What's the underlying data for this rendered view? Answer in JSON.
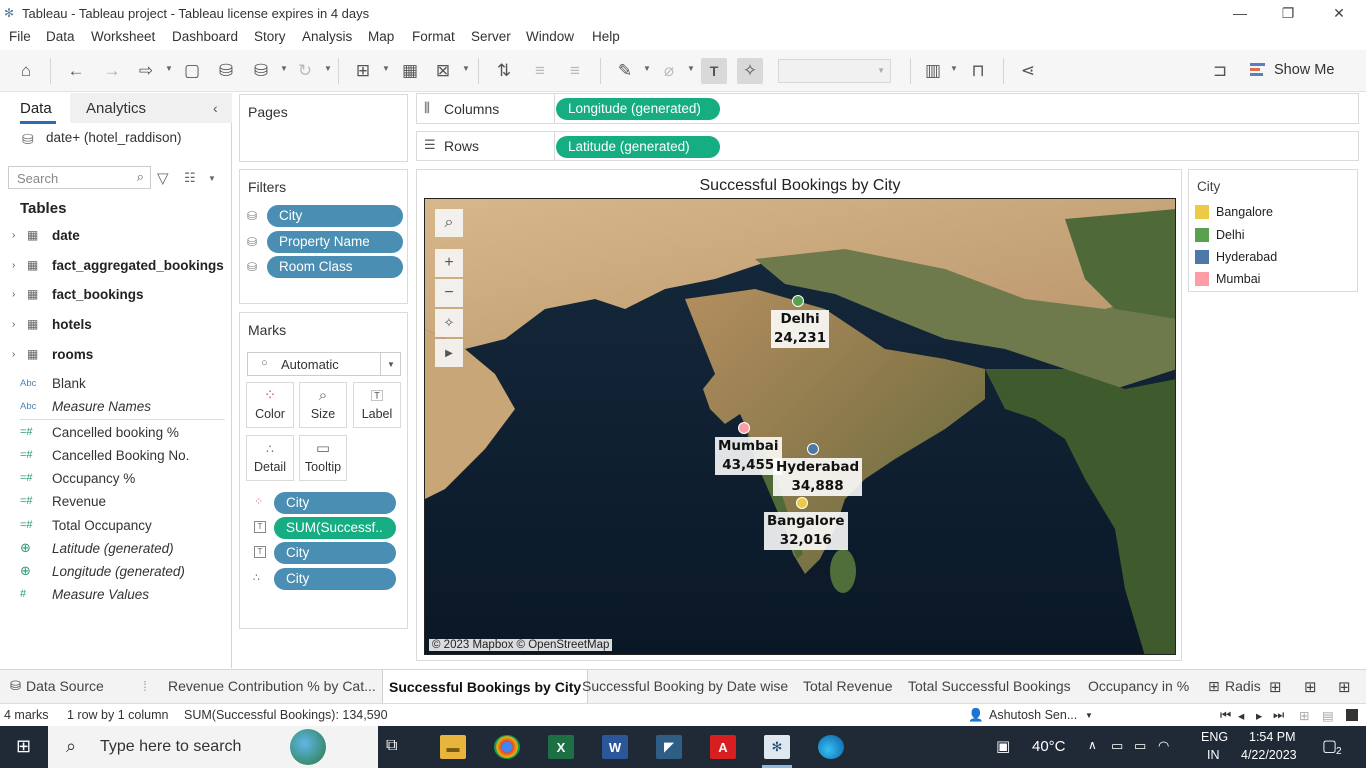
{
  "window": {
    "title": "Tableau - Tableau project - Tableau license expires in 4 days",
    "minimize": "—",
    "restore": "❐",
    "close": "✕"
  },
  "menu": [
    "File",
    "Data",
    "Worksheet",
    "Dashboard",
    "Story",
    "Analysis",
    "Map",
    "Format",
    "Server",
    "Window",
    "Help"
  ],
  "toolbar": {
    "show_me_label": "Show Me"
  },
  "data_pane": {
    "tab_data": "Data",
    "tab_analytics": "Analytics",
    "datasource": "date+ (hotel_raddison)",
    "search_placeholder": "Search",
    "tables_heading": "Tables",
    "tables": [
      "date",
      "fact_aggregated_bookings",
      "fact_bookings",
      "hotels",
      "rooms"
    ],
    "fields": [
      {
        "icon": "Abc",
        "label": "Blank",
        "italic": false
      },
      {
        "icon": "Abc",
        "label": "Measure Names",
        "italic": true
      },
      {
        "icon": "=#",
        "label": "Cancelled booking %",
        "italic": false
      },
      {
        "icon": "=#",
        "label": "Cancelled Booking No.",
        "italic": false
      },
      {
        "icon": "=#",
        "label": "Occupancy %",
        "italic": false
      },
      {
        "icon": "=#",
        "label": "Revenue",
        "italic": false
      },
      {
        "icon": "=#",
        "label": "Total Occupancy",
        "italic": false
      },
      {
        "icon": "globe",
        "label": "Latitude (generated)",
        "italic": true
      },
      {
        "icon": "globe",
        "label": "Longitude (generated)",
        "italic": true
      },
      {
        "icon": "#",
        "label": "Measure Values",
        "italic": true
      }
    ]
  },
  "pages": {
    "title": "Pages"
  },
  "filters": {
    "title": "Filters",
    "items": [
      "City",
      "Property Name",
      "Room Class"
    ]
  },
  "marks": {
    "title": "Marks",
    "type": "Automatic",
    "buttons": [
      "Color",
      "Size",
      "Label",
      "Detail",
      "Tooltip"
    ],
    "pills": [
      "City",
      "SUM(Successf..",
      "City",
      "City"
    ]
  },
  "shelves": {
    "columns_label": "Columns",
    "columns_pill": "Longitude (generated)",
    "rows_label": "Rows",
    "rows_pill": "Latitude (generated)"
  },
  "view": {
    "title": "Successful Bookings by City",
    "attribution": "© 2023 Mapbox © OpenStreetMap",
    "points": [
      {
        "city": "Delhi",
        "value": "24,231",
        "color": "#59a14f"
      },
      {
        "city": "Mumbai",
        "value": "43,455",
        "color": "#ff9da7"
      },
      {
        "city": "Hyderabad",
        "value": "34,888",
        "color": "#4e79a7"
      },
      {
        "city": "Bangalore",
        "value": "32,016",
        "color": "#edc948"
      }
    ]
  },
  "legend": {
    "title": "City",
    "items": [
      {
        "label": "Bangalore",
        "color": "#edc948"
      },
      {
        "label": "Delhi",
        "color": "#59a14f"
      },
      {
        "label": "Hyderabad",
        "color": "#4e79a7"
      },
      {
        "label": "Mumbai",
        "color": "#ff9da7"
      }
    ]
  },
  "sheet_tabs": {
    "data_source": "Data Source",
    "tabs": [
      "Revenue Contribution % by Cat...",
      "Successful Bookings by City",
      "Successful Booking by Date wise",
      "Total Revenue",
      "Total Successful Bookings",
      "Occupancy in %",
      "Radis"
    ],
    "active": "Successful Bookings by City"
  },
  "status": {
    "marks": "4 marks",
    "dims": "1 row by 1 column",
    "sum": "SUM(Successful Bookings): 134,590",
    "user": "Ashutosh Sen..."
  },
  "taskbar": {
    "search_placeholder": "Type here to search",
    "temperature": "40°C",
    "lang1": "ENG",
    "lang2": "IN",
    "time": "1:54 PM",
    "date": "4/22/2023",
    "notifications": "2"
  }
}
